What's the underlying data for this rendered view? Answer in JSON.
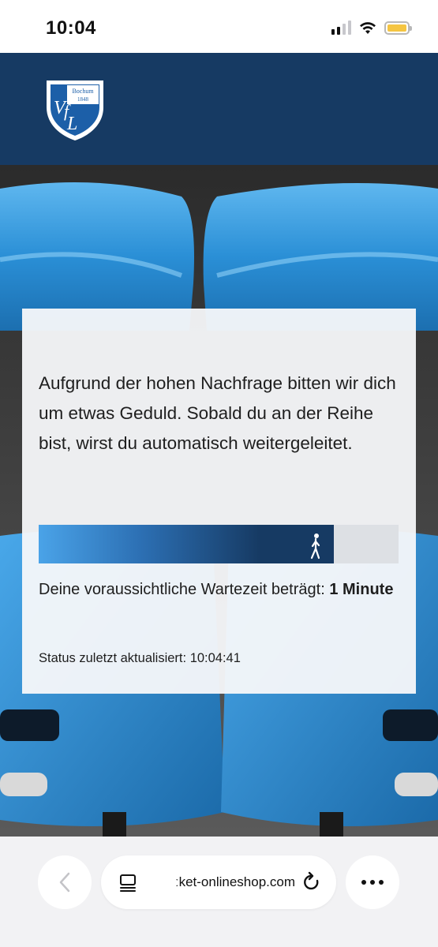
{
  "status_bar": {
    "time": "10:04",
    "icons": [
      "cellular-signal-icon",
      "wifi-icon",
      "battery-icon"
    ],
    "battery_color": "#f5c542"
  },
  "header": {
    "logo": {
      "name": "vfl-bochum-logo",
      "text_top": "Bochum",
      "text_year": "1848",
      "text_main": "VfL"
    },
    "background_color": "#163a63"
  },
  "queue": {
    "message": "Aufgrund der hohen Nachfrage bitten wir dich um etwas Geduld. Sobald du an der Reihe bist, wirst du automatisch weitergeleitet.",
    "progress_fraction": 0.82,
    "wait_label": "Deine voraussichtliche Wartezeit beträgt:",
    "wait_value": "1 Minute",
    "status_label": "Status zuletzt aktualisiert:",
    "status_time": "10:04:41"
  },
  "browser": {
    "url": "ticket-onlineshop.com",
    "url_visible": "ːket-onlineshop.com",
    "icons": [
      "back-arrow-icon",
      "tabs-icon",
      "reload-icon",
      "more-icon"
    ]
  },
  "colors": {
    "primary_blue": "#163a63",
    "seat_blue": "#2a8fd6"
  }
}
